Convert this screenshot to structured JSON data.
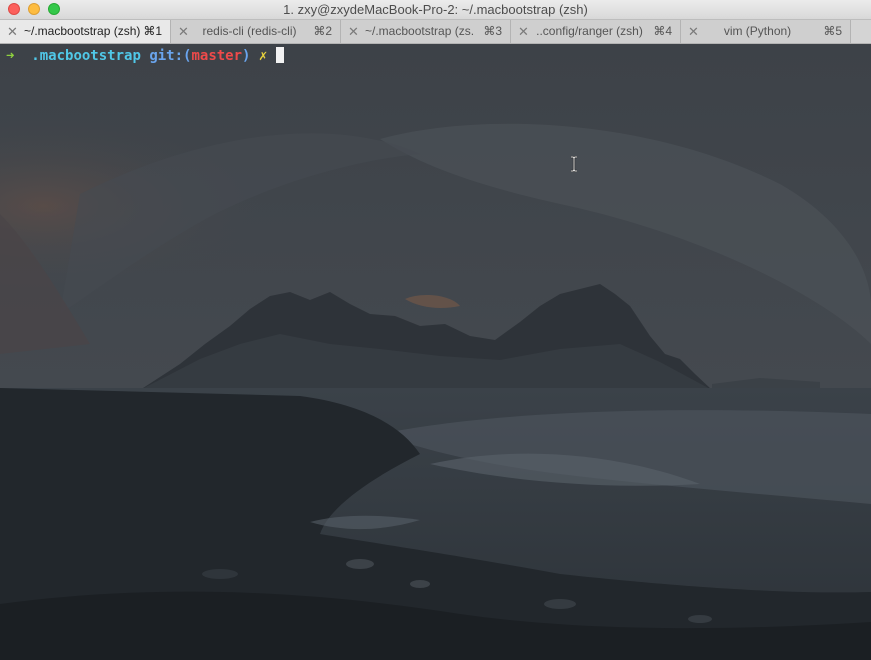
{
  "window": {
    "title": "1. zxy@zxydeMacBook-Pro-2: ~/.macbootstrap (zsh)"
  },
  "tabs": [
    {
      "label": "~/.macbootstrap (zsh)",
      "shortcut": "⌘1",
      "active": true
    },
    {
      "label": "redis-cli (redis-cli)",
      "shortcut": "⌘2",
      "active": false
    },
    {
      "label": "~/.macbootstrap (zs...",
      "shortcut": "⌘3",
      "active": false
    },
    {
      "label": "..config/ranger (zsh)",
      "shortcut": "⌘4",
      "active": false
    },
    {
      "label": "vim (Python)",
      "shortcut": "⌘5",
      "active": false
    }
  ],
  "terminal": {
    "prompt_arrow": "➜",
    "directory": ".macbootstrap",
    "git_prefix": "git:(",
    "branch": "master",
    "git_suffix": ")",
    "dirty_marker": "✗",
    "input": ""
  },
  "icons": {
    "tab_close": "close-icon",
    "pointer": "i-beam-cursor-icon"
  },
  "colors": {
    "prompt_arrow": "#8fd23f",
    "directory": "#50c8e8",
    "git": "#6aa5ee",
    "branch": "#ef4a4a",
    "dirty": "#e8d23c",
    "cursor": "#f2f2f2"
  }
}
